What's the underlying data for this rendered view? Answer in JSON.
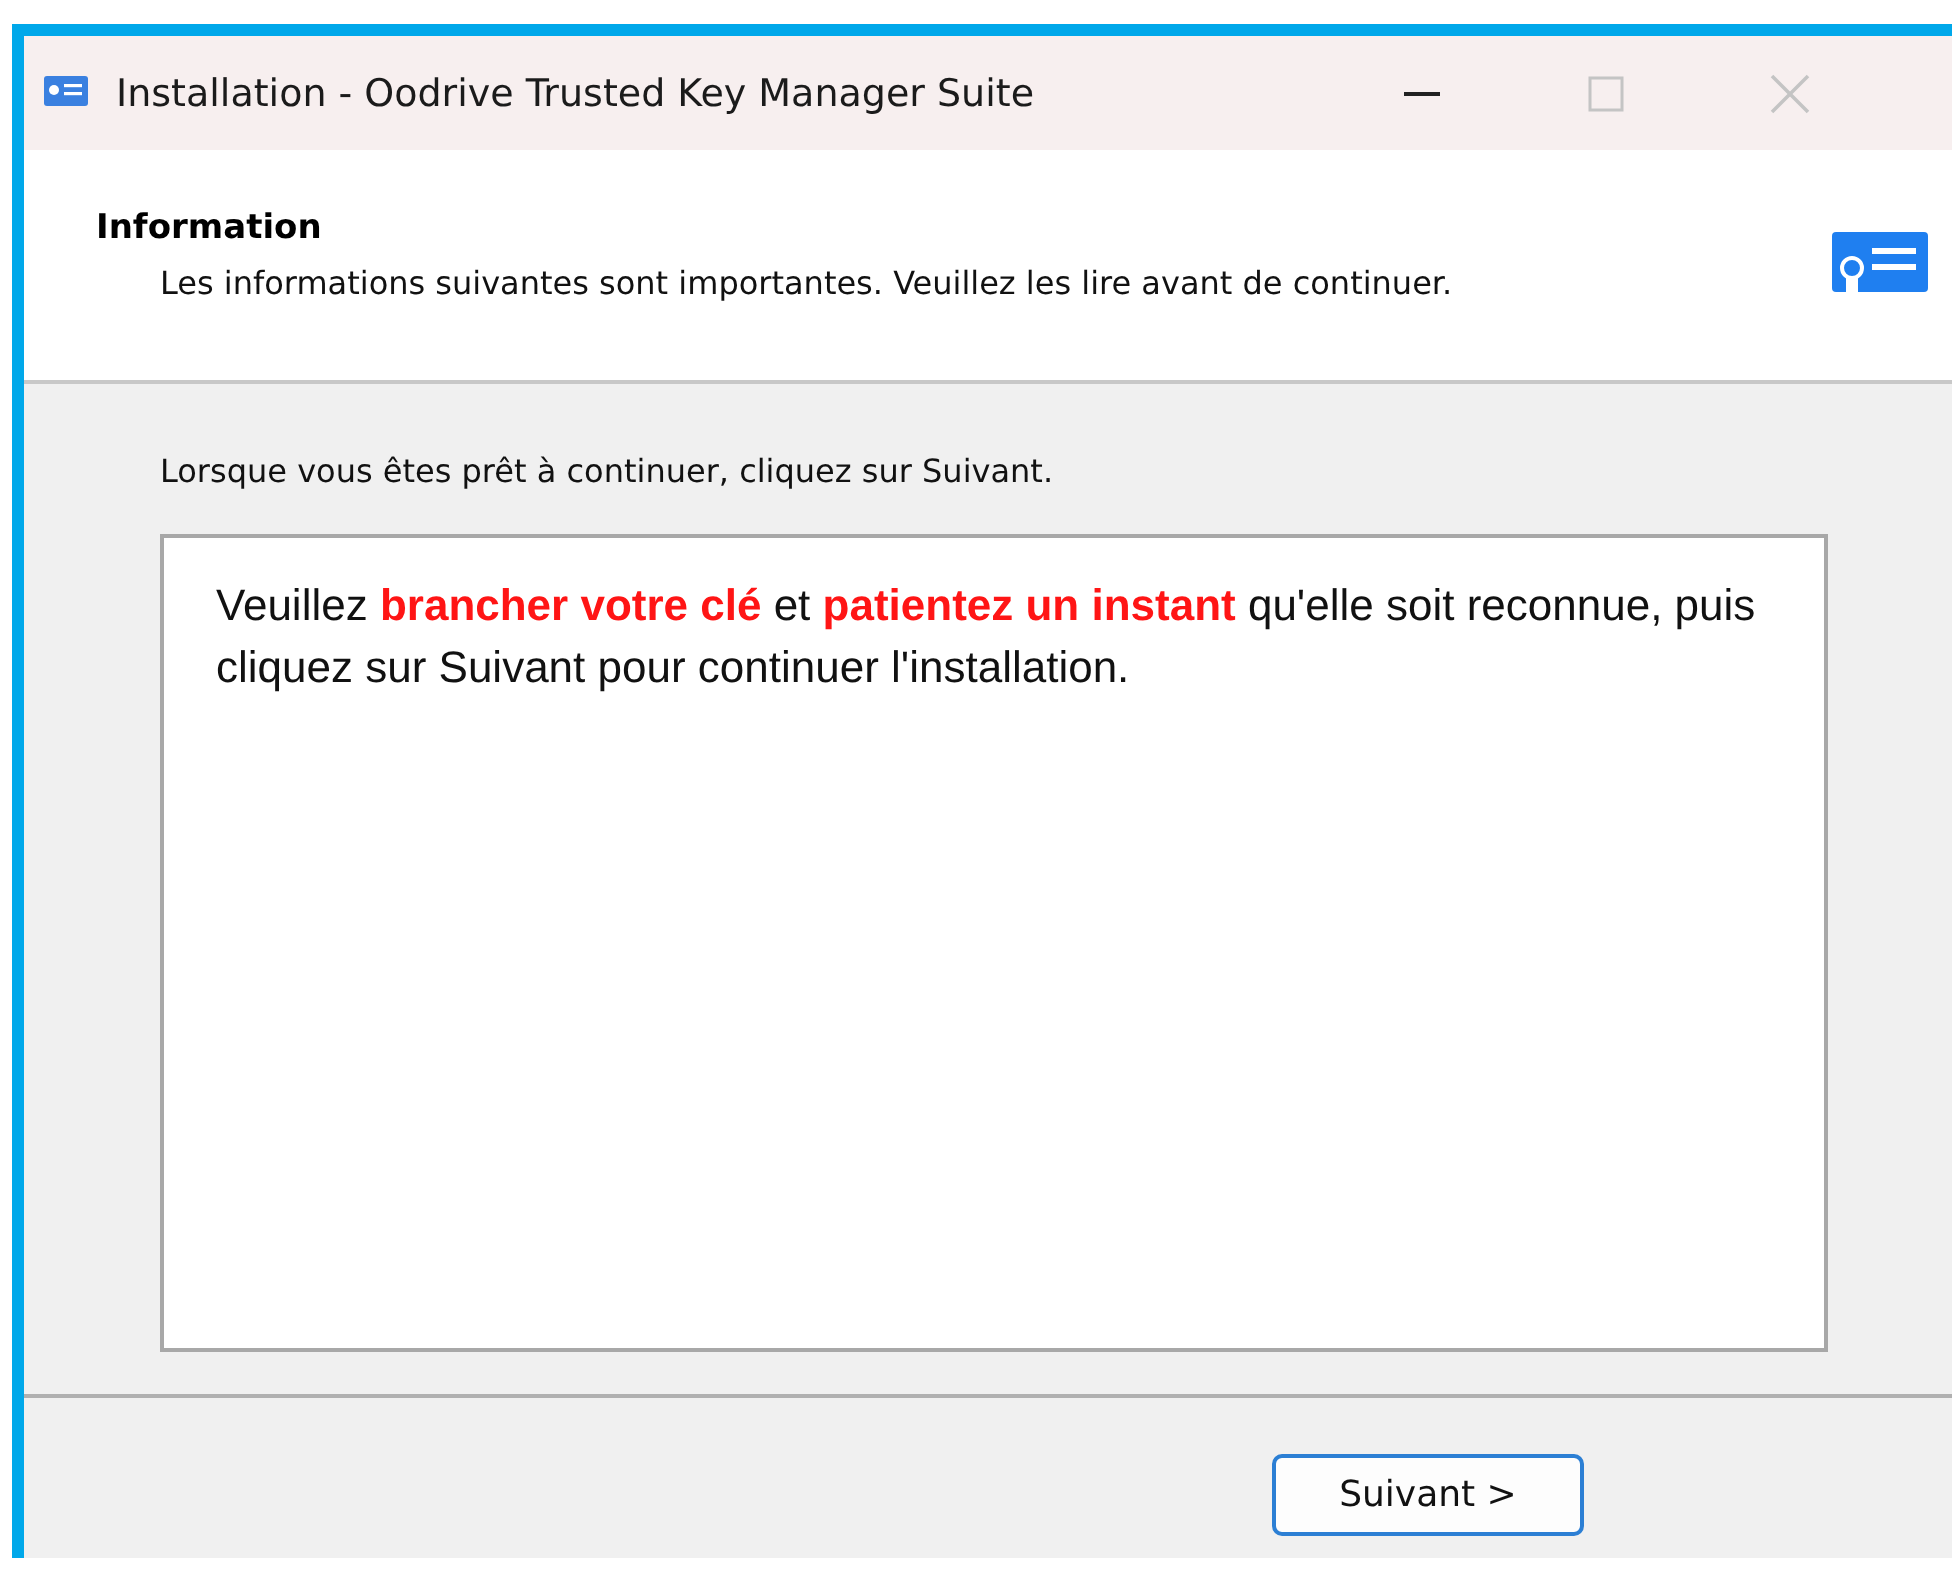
{
  "window": {
    "title": "Installation - Oodrive Trusted Key Manager Suite",
    "controls": [
      {
        "kind": "minimize",
        "disabled": false
      },
      {
        "kind": "maximize",
        "disabled": true
      },
      {
        "kind": "close",
        "disabled": true
      }
    ]
  },
  "header": {
    "title": "Information",
    "subtitle": "Les informations suivantes sont importantes. Veuillez les lire avant de continuer."
  },
  "instruction": "Lorsque vous êtes prêt à continuer, cliquez sur Suivant.",
  "memo": "Veuillez **brancher votre clé** et **patientez un instant** qu'elle soit reconnue, puis cliquez sur Suivant pour continuer l'installation.",
  "buttons": [
    {
      "label": "Suivant >",
      "default": true
    }
  ]
}
